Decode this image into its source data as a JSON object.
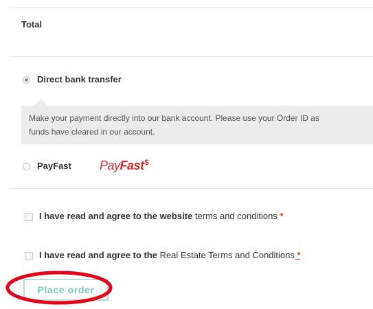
{
  "order_review": {
    "total_label": "Total"
  },
  "payment_methods": [
    {
      "label": "Direct bank transfer",
      "selected": true,
      "description": "Make your payment directly into our bank account. Please use your Order ID as",
      "description_line2": "funds have cleared in our account."
    },
    {
      "label": "PayFast",
      "selected": false,
      "logo_text_pay": "Pay",
      "logo_text_fast": "Fast",
      "logo_mark": "$"
    }
  ],
  "terms": [
    {
      "prefix_bold": "I have read and agree to the website",
      "link_text": " terms and conditions",
      "required_marker": " *"
    },
    {
      "prefix_bold": "I have read and agree to the",
      "link_text": " Real Estate Terms and Conditions",
      "required_marker": " *"
    }
  ],
  "place_order_label": "Place order",
  "colors": {
    "required": "#e2401c",
    "button_text": "#7ec4c4",
    "button_border": "#b5dcdc",
    "highlight_ring": "#e5001a",
    "payfast_brand": "#d9272e"
  }
}
